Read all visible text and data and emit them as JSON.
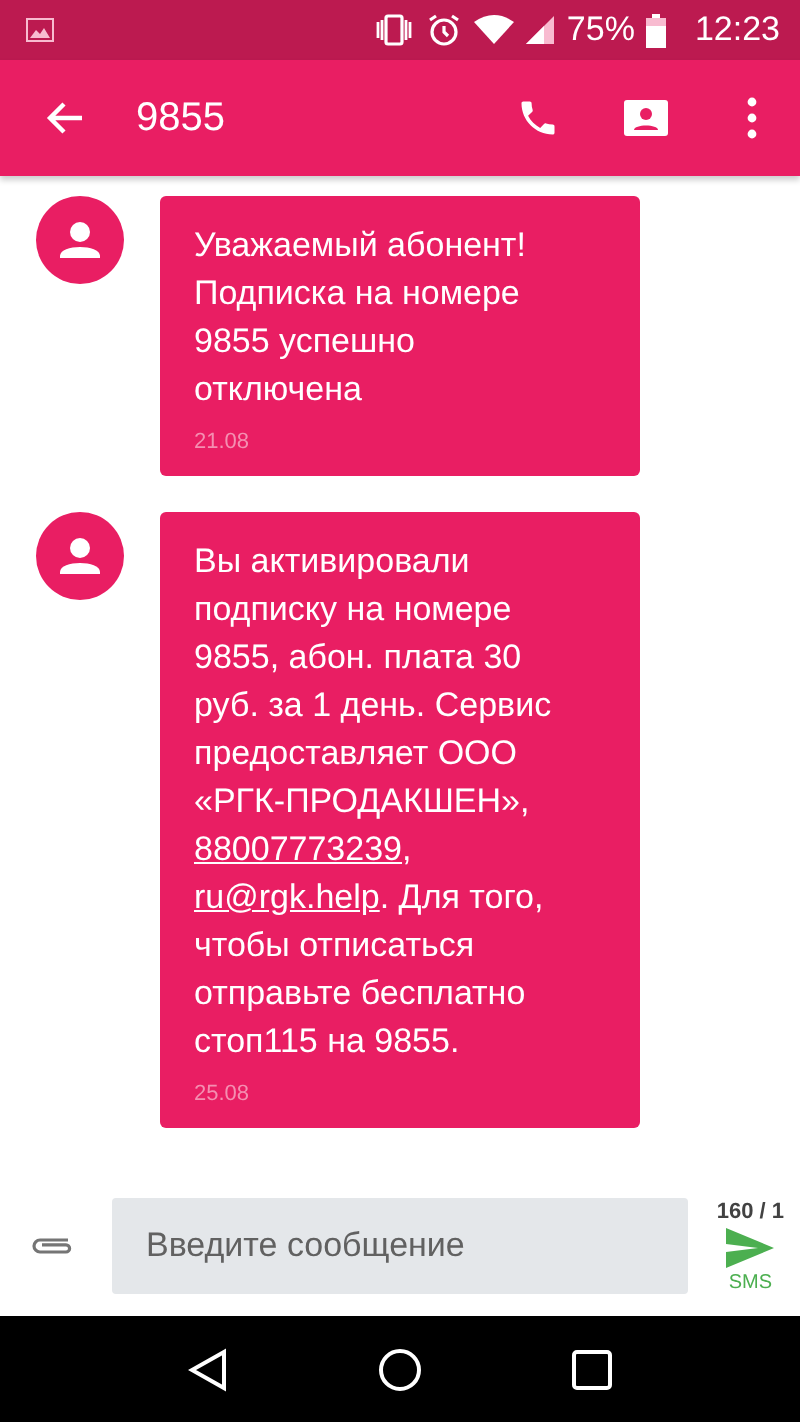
{
  "status_bar": {
    "battery": "75%",
    "time": "12:23"
  },
  "app_bar": {
    "title": "9855"
  },
  "messages": [
    {
      "parts": [
        {
          "kind": "text",
          "text": "Уважаемый абонент!\nПодписка на номере\n9855 успешно\nотключена"
        }
      ],
      "date": "21.08"
    },
    {
      "parts": [
        {
          "kind": "text",
          "text": "Вы активировали\nподписку на номере\n9855, абон. плата 30\nруб. за 1 день. Сервис\nпредоставляет ООО\n«РГК-ПРОДАКШЕН»,\n"
        },
        {
          "kind": "link",
          "text": "88007773239"
        },
        {
          "kind": "text",
          "text": ",\n"
        },
        {
          "kind": "link",
          "text": "ru@rgk.help"
        },
        {
          "kind": "text",
          "text": ". Для того,\nчтобы отписаться\nотправьте бесплатно\nстоп115 на 9855."
        }
      ],
      "date": "25.08"
    }
  ],
  "composer": {
    "placeholder": "Введите сообщение",
    "counter": "160 / 1",
    "send_label": "SMS"
  }
}
